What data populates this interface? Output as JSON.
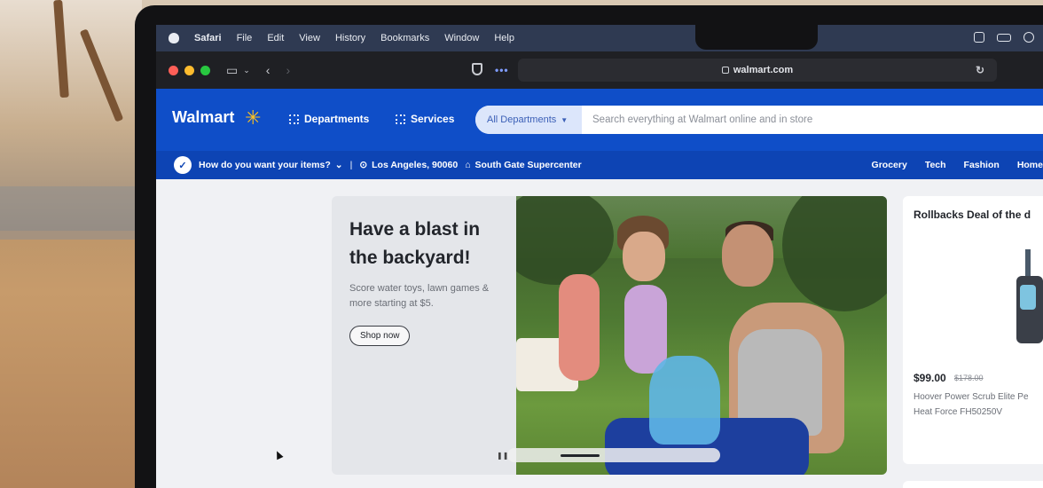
{
  "menubar": {
    "app": "Safari",
    "items": [
      "File",
      "Edit",
      "View",
      "History",
      "Bookmarks",
      "Window",
      "Help"
    ]
  },
  "browser": {
    "url": "walmart.com"
  },
  "header": {
    "logo": "Walmart",
    "departments": "Departments",
    "services": "Services",
    "dept_select": "All Departments",
    "search_placeholder": "Search everything at Walmart online and in store"
  },
  "subbar": {
    "delivery_prompt": "How do you want your items?",
    "location": "Los Angeles, 90060",
    "store": "South Gate Supercenter",
    "categories": [
      "Grocery",
      "Tech",
      "Fashion",
      "Home"
    ]
  },
  "promo": {
    "title": "Have a blast in the backyard!",
    "subtitle": "Score water toys, lawn games & more starting at $5.",
    "button": "Shop now",
    "slide_progress": 0.3
  },
  "rollbacks": {
    "title": "Rollbacks Deal of the d",
    "price": "$99.00",
    "old_price": "$178.00",
    "product": "Hoover Power Scrub Elite Pe Heat Force FH50250V"
  },
  "colors": {
    "walmart_blue": "#0f4ec8",
    "walmart_yellow": "#ffc220",
    "traffic_red": "#ff5f57",
    "traffic_yellow": "#febc2e",
    "traffic_green": "#28c840"
  }
}
